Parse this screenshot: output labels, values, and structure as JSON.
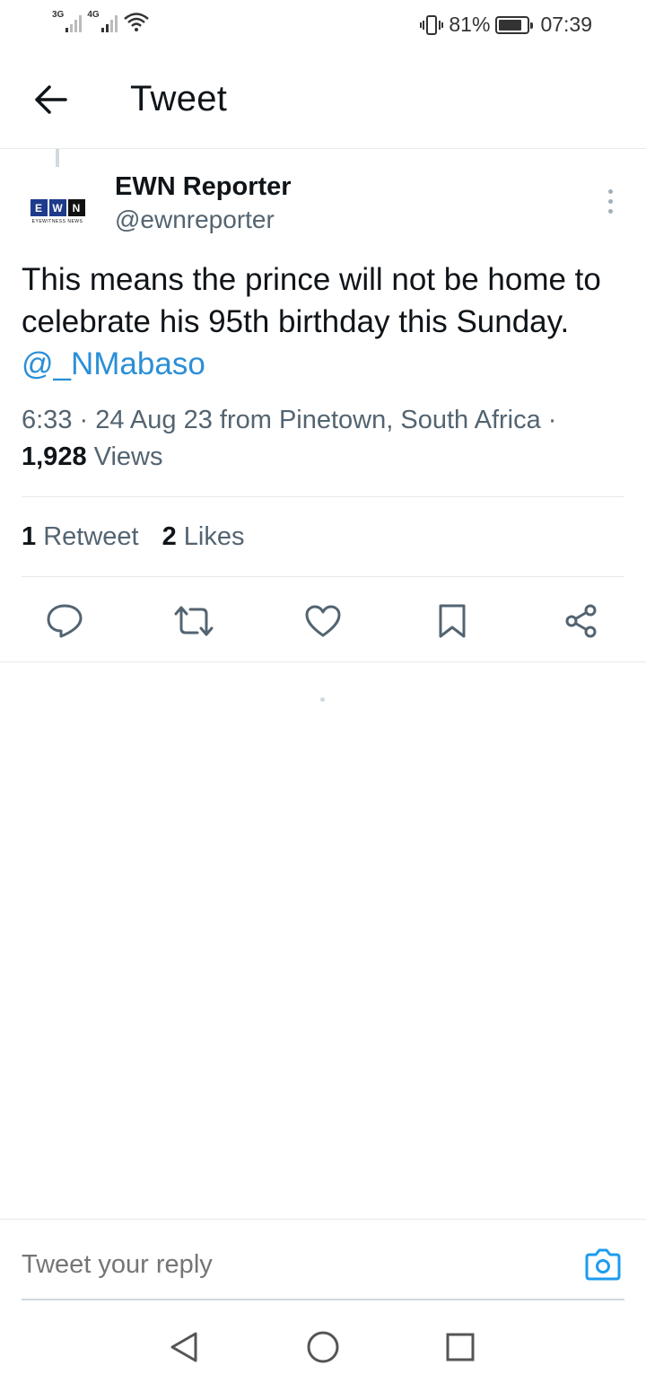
{
  "status_bar": {
    "net1": "3G",
    "net2": "4G",
    "battery_percent": "81%",
    "battery_level": 0.81,
    "time": "07:39",
    "icons": [
      "signal-icon",
      "wifi-icon",
      "vibrate-icon",
      "battery-icon"
    ]
  },
  "header": {
    "title": "Tweet",
    "back_icon": "arrow-left-icon"
  },
  "tweet": {
    "author_name": "EWN Reporter",
    "author_handle": "@ewnreporter",
    "avatar": {
      "letters": [
        "E",
        "W",
        "N"
      ],
      "subtitle": "EYEWITNESS NEWS"
    },
    "text": "This means the prince will not be home to celebrate his 95th birthday this Sunday.",
    "mention": "@_NMabaso",
    "meta": "6:33 · 24 Aug 23 from Pinetown, South Africa ·",
    "views_count": "1,928",
    "views_label": "Views",
    "retweet_count": "1",
    "retweet_label": "Retweet",
    "likes_count": "2",
    "likes_label": "Likes"
  },
  "actions": [
    "reply-icon",
    "retweet-icon",
    "like-icon",
    "bookmark-icon",
    "share-icon"
  ],
  "reply": {
    "placeholder": "Tweet your reply",
    "accent": "#1d9bf0"
  },
  "nav": [
    "back-triangle-icon",
    "home-circle-icon",
    "recents-square-icon"
  ]
}
